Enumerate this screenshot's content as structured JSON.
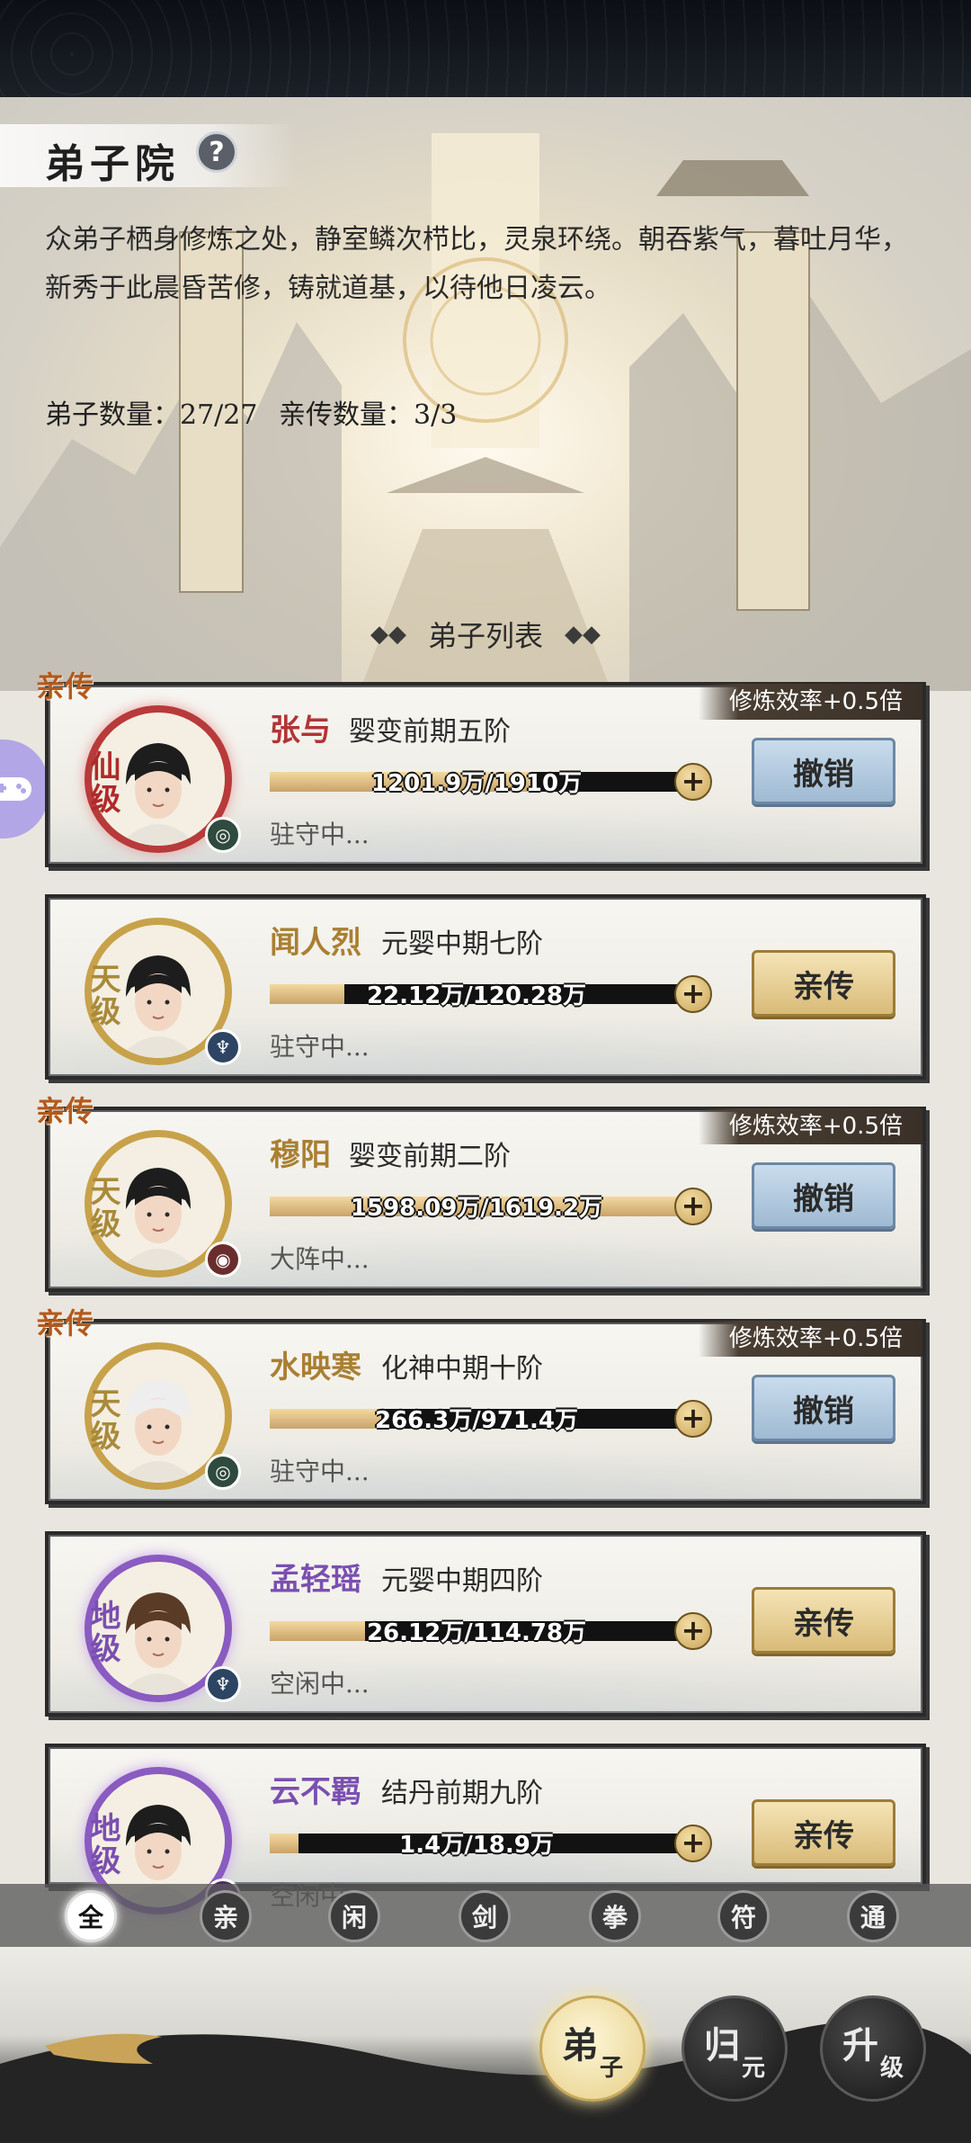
{
  "header": {
    "title": "弟子院",
    "help_icon": "?",
    "description": "众弟子栖身修炼之处，静室鳞次栉比，灵泉环绕。朝吞紫气，暮吐月华，新秀于此晨昏苦修，铸就道基，以待他日凌云。",
    "disciple_count": "弟子数量：27/27",
    "direct_count": "亲传数量：3/3"
  },
  "list_header": {
    "title": "弟子列表",
    "left_ornament": "◆◆",
    "right_ornament": "◆◆"
  },
  "side_icon": "gamepad-icon",
  "disciples": [
    {
      "direct_tag": "亲传",
      "bonus": "修炼效率+0.5倍",
      "name": "张与",
      "realm": "婴变前期五阶",
      "grade": "仙级",
      "exp": "1201.9万/1910万",
      "progress": 0.63,
      "status": "驻守中...",
      "action": "撤销"
    },
    {
      "direct_tag": "",
      "bonus": "",
      "name": "闻人烈",
      "realm": "元婴中期七阶",
      "grade": "天级",
      "exp": "22.12万/120.28万",
      "progress": 0.18,
      "status": "驻守中...",
      "action": "亲传"
    },
    {
      "direct_tag": "亲传",
      "bonus": "修炼效率+0.5倍",
      "name": "穆阳",
      "realm": "婴变前期二阶",
      "grade": "天级",
      "exp": "1598.09万/1619.2万",
      "progress": 0.99,
      "status": "大阵中...",
      "action": "撤销"
    },
    {
      "direct_tag": "亲传",
      "bonus": "修炼效率+0.5倍",
      "name": "水映寒",
      "realm": "化神中期十阶",
      "grade": "天级",
      "exp": "266.3万/971.4万",
      "progress": 0.27,
      "status": "驻守中...",
      "action": "撤销"
    },
    {
      "direct_tag": "",
      "bonus": "",
      "name": "孟轻瑶",
      "realm": "元婴中期四阶",
      "grade": "地级",
      "exp": "26.12万/114.78万",
      "progress": 0.23,
      "status": "空闲中...",
      "action": "亲传"
    },
    {
      "direct_tag": "",
      "bonus": "",
      "name": "云不羁",
      "realm": "结丹前期九阶",
      "grade": "地级",
      "exp": "1.4万/18.9万",
      "progress": 0.07,
      "status": "空闲中...",
      "action": "亲传"
    }
  ],
  "filters": [
    "全",
    "亲",
    "闲",
    "剑",
    "拳",
    "符",
    "通"
  ],
  "bottom_nav": {
    "disciple": {
      "main": "弟",
      "sub": "子"
    },
    "return": {
      "main": "归",
      "sub": "元"
    },
    "upgrade": {
      "main": "升",
      "sub": "级"
    }
  },
  "colors": {
    "revoke_button": "#9fbad3",
    "promote_button": "#d9bb78",
    "direct_tag": "#b25a1f",
    "xian_grade": "#b02a2a",
    "tian_grade": "#a98a3a",
    "di_grade": "#7a4fb0"
  }
}
